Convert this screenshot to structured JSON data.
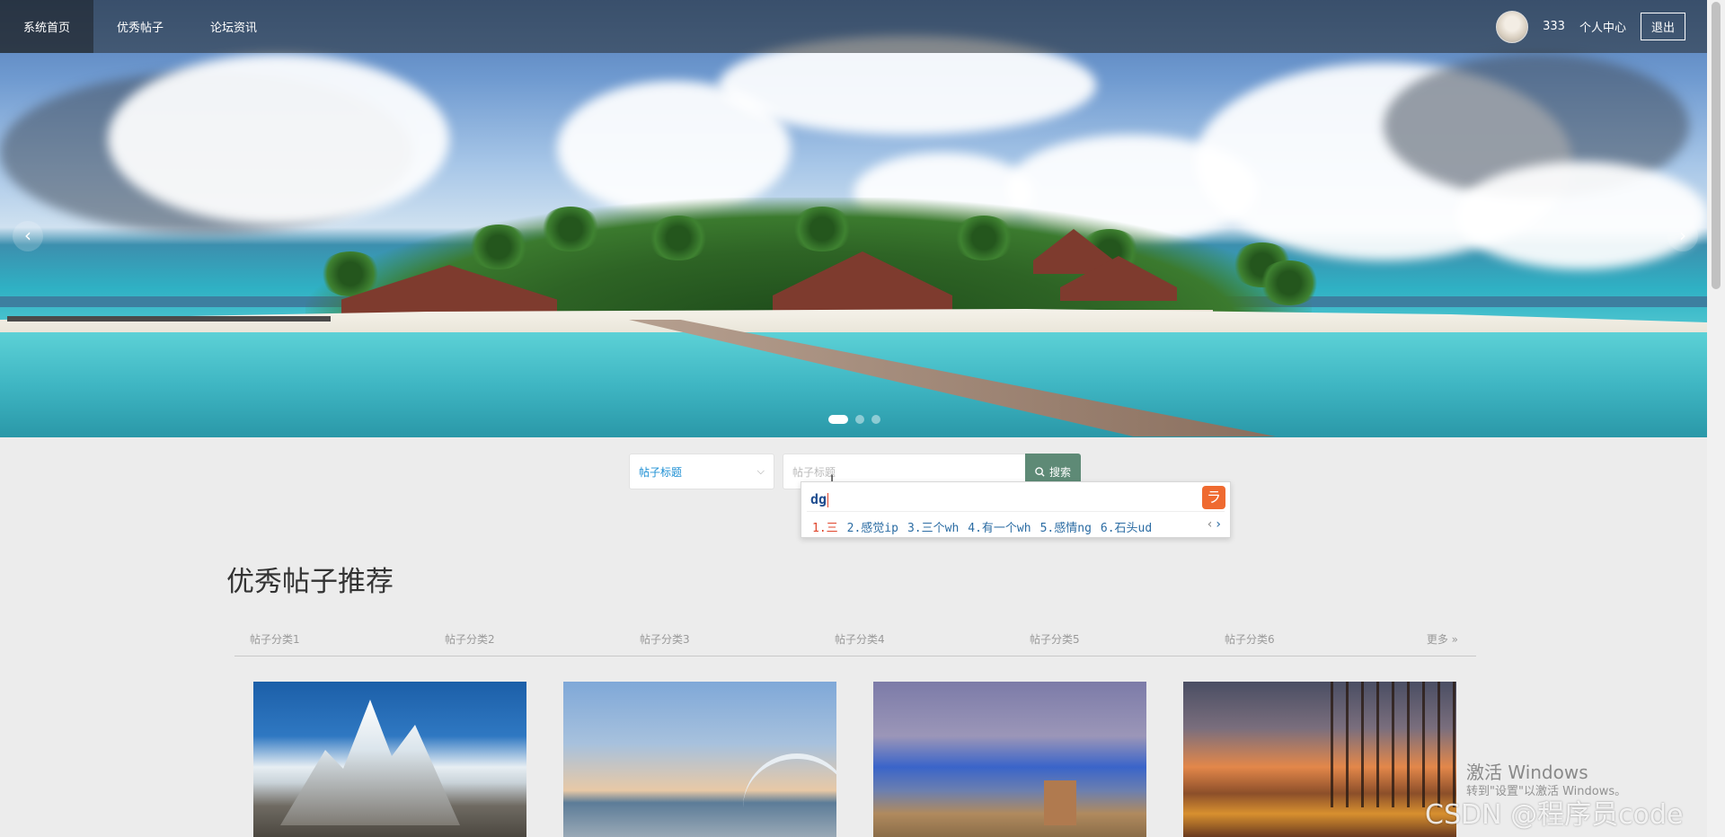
{
  "nav": {
    "items": [
      {
        "label": "系统首页"
      },
      {
        "label": "优秀帖子"
      },
      {
        "label": "论坛资讯"
      }
    ],
    "username": "333",
    "profile_label": "个人中心",
    "logout_label": "退出"
  },
  "hero": {
    "prev_icon": "chevron-left-icon",
    "next_icon": "chevron-right-icon",
    "slide_count": 3,
    "active_slide": 1
  },
  "search": {
    "select_value": "帖子标题",
    "input_placeholder": "帖子标题",
    "button_label": "搜索",
    "button_icon": "search-icon"
  },
  "ime": {
    "composition": "dg",
    "candidates": [
      "1.三",
      "2.感觉ip",
      "3.三个wh",
      "4.有一个wh",
      "5.感情ng",
      "6.石头ud"
    ]
  },
  "recommend": {
    "title": "优秀帖子推荐",
    "categories": [
      "帖子分类1",
      "帖子分类2",
      "帖子分类3",
      "帖子分类4",
      "帖子分类5",
      "帖子分类6"
    ],
    "more_label": "更多 »"
  },
  "watermark": {
    "activate_title": "激活 Windows",
    "activate_sub": "转到\"设置\"以激活 Windows。",
    "csdn": "CSDN @程序员code"
  },
  "colors": {
    "search_button": "#5e8a76",
    "select_text": "#1e90d4",
    "ime_logo": "#ef6a30"
  }
}
